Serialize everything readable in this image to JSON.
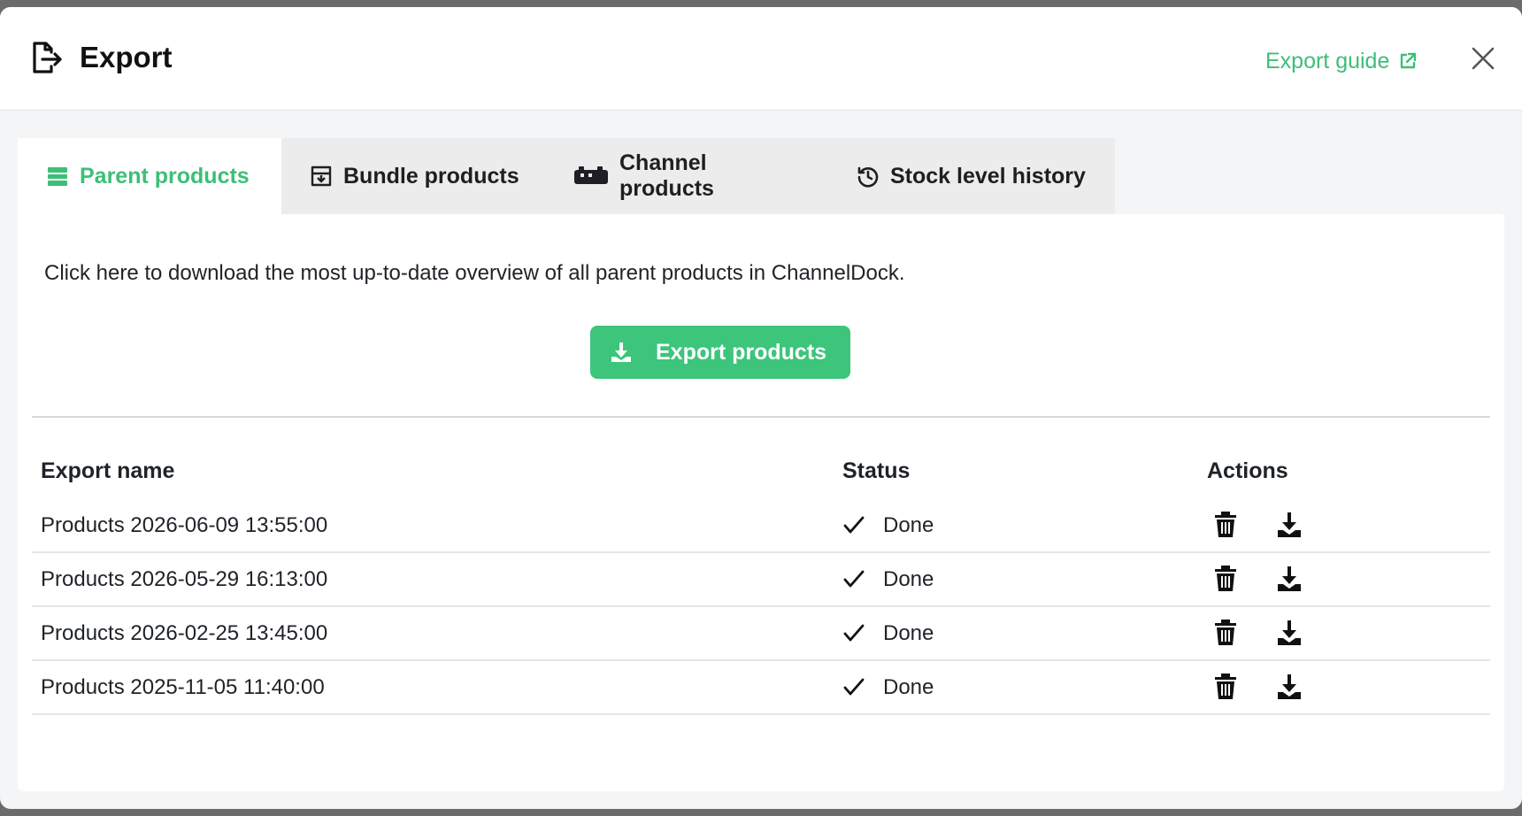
{
  "modal": {
    "title": "Export",
    "guide_label": "Export guide",
    "accent_color": "#3cbf77"
  },
  "tabs": [
    {
      "label": "Parent products",
      "icon": "layers-icon",
      "active": true
    },
    {
      "label": "Bundle products",
      "icon": "box-icon",
      "active": false
    },
    {
      "label": "Channel products",
      "icon": "channel-icon",
      "active": false
    },
    {
      "label": "Stock level history",
      "icon": "history-icon",
      "active": false
    }
  ],
  "panel": {
    "intro": "Click here to download the most up-to-date overview of all parent products in ChannelDock.",
    "export_button": "Export products"
  },
  "table": {
    "headers": {
      "name": "Export name",
      "status": "Status",
      "actions": "Actions"
    },
    "rows": [
      {
        "name": "Products 2026-06-09 13:55:00",
        "status": "Done"
      },
      {
        "name": "Products 2026-05-29 16:13:00",
        "status": "Done"
      },
      {
        "name": "Products 2026-02-25 13:45:00",
        "status": "Done"
      },
      {
        "name": "Products 2025-11-05 11:40:00",
        "status": "Done"
      }
    ]
  }
}
